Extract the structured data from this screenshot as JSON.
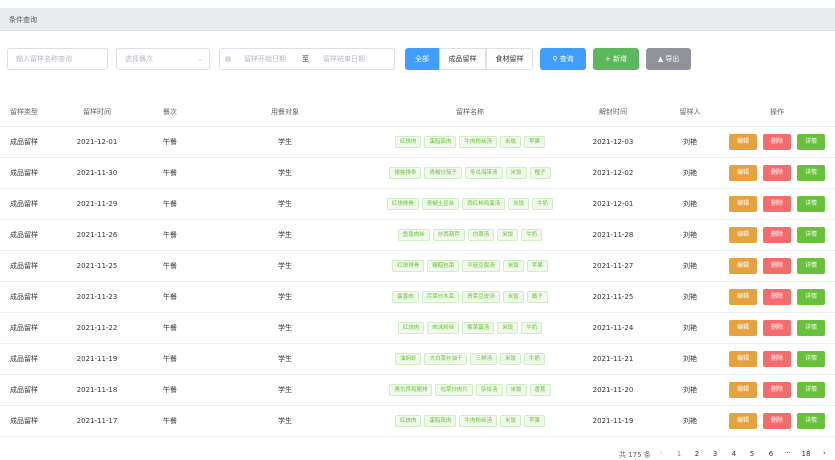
{
  "condition_bar": {
    "title": "条件查询"
  },
  "filters": {
    "name_placeholder": "输入留样名称查询",
    "meal_placeholder": "选择餐次",
    "date_start_placeholder": "留样开始日期",
    "date_separator": "至",
    "date_end_placeholder": "留样结束日期",
    "segments": [
      "全部",
      "成品留样",
      "食材留样"
    ],
    "query_label": "查询",
    "add_label": "+ 新增",
    "export_label": "导出"
  },
  "table": {
    "headers": [
      "留样类型",
      "留样时间",
      "餐次",
      "用餐对象",
      "留样名称",
      "解封时间",
      "留样人",
      "操作"
    ],
    "op_labels": {
      "edit": "编辑",
      "delete": "删除",
      "detail": "详情"
    },
    "rows": [
      {
        "type": "成品留样",
        "time": "2021-12-01",
        "meal": "午餐",
        "target": "学生",
        "names": [
          "红烧肉",
          "蛋脂蒸肉",
          "牛肉粉丝汤",
          "米饭",
          "苹果"
        ],
        "seal": "2021-12-03",
        "person": "刘艳"
      },
      {
        "type": "成品留样",
        "time": "2021-11-30",
        "meal": "午餐",
        "target": "学生",
        "names": [
          "椒盐排条",
          "青椒炒茄子",
          "冬瓜海带汤",
          "米饭",
          "橙子"
        ],
        "seal": "2021-12-02",
        "person": "刘艳"
      },
      {
        "type": "成品留样",
        "time": "2021-11-29",
        "meal": "午餐",
        "target": "学生",
        "names": [
          "红烧排骨",
          "青椒土豆丝",
          "西红柿鸡蛋汤",
          "米饭",
          "牛奶"
        ],
        "seal": "2021-12-01",
        "person": "刘艳"
      },
      {
        "type": "成品留样",
        "time": "2021-11-26",
        "meal": "午餐",
        "target": "学生",
        "names": [
          "鱼香肉丝",
          "炒西葫芦",
          "白菜汤",
          "米饭",
          "牛奶"
        ],
        "seal": "2021-11-28",
        "person": "刘艳"
      },
      {
        "type": "成品留样",
        "time": "2021-11-25",
        "meal": "午餐",
        "target": "学生",
        "names": [
          "红烧排骨",
          "糖醋包菜",
          "平菇豆腐汤",
          "米饭",
          "苹果"
        ],
        "seal": "2021-11-27",
        "person": "刘艳"
      },
      {
        "type": "成品留样",
        "time": "2021-11-23",
        "meal": "午餐",
        "target": "学生",
        "names": [
          "蛋香肉",
          "芹菜炒木耳",
          "青菜豆皮汤",
          "米饭",
          "橘子"
        ],
        "seal": "2021-11-25",
        "person": "刘艳"
      },
      {
        "type": "成品留样",
        "time": "2021-11-22",
        "meal": "午餐",
        "target": "学生",
        "names": [
          "红烧肉",
          "肉沫粉丝",
          "紫菜蛋汤",
          "米饭",
          "牛奶"
        ],
        "seal": "2021-11-24",
        "person": "刘艳"
      },
      {
        "type": "成品留样",
        "time": "2021-11-19",
        "meal": "午餐",
        "target": "学生",
        "names": [
          "油焖虾",
          "大白菜炒油干",
          "三鲜汤",
          "米饭",
          "牛奶"
        ],
        "seal": "2021-11-21",
        "person": "刘艳"
      },
      {
        "type": "成品留样",
        "time": "2021-11-18",
        "meal": "午餐",
        "target": "学生",
        "names": [
          "奥尔良鸡腿排",
          "包菜炒肉片",
          "杂烩汤",
          "米饭",
          "香蕉"
        ],
        "seal": "2021-11-20",
        "person": "刘艳"
      },
      {
        "type": "成品留样",
        "time": "2021-11-17",
        "meal": "午餐",
        "target": "学生",
        "names": [
          "红烧肉",
          "蛋脂蒸肉",
          "牛肉粉丝汤",
          "米饭",
          "苹果"
        ],
        "seal": "2021-11-19",
        "person": "刘艳"
      }
    ]
  },
  "pagination": {
    "total": "共 175 条",
    "pages": [
      "1",
      "2",
      "3",
      "4",
      "5",
      "6"
    ],
    "current": "1",
    "ellipsis": "···",
    "last": "18"
  },
  "colors": {
    "primary": "#409eff",
    "success": "#67c23a",
    "warning": "#e6a23c",
    "danger": "#f56c6c",
    "info": "#909399"
  }
}
